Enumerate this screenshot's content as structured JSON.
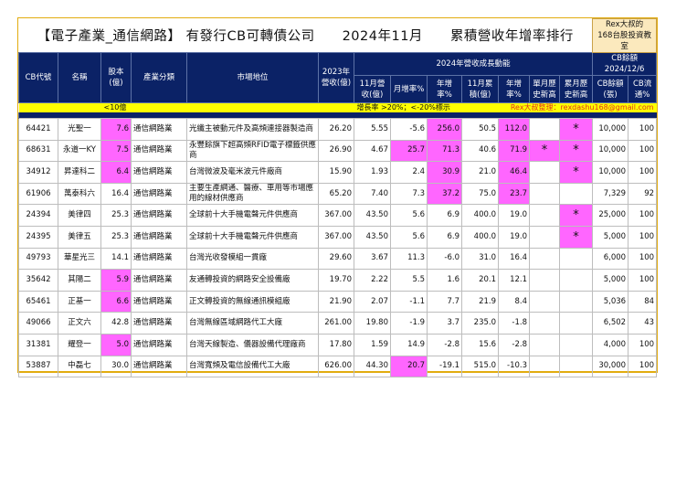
{
  "title": {
    "main": "【電子產業_通信網路】 有發行CB可轉債公司　　2024年11月　　累積營收年增率排行",
    "rex_line1": "Rex大叔的",
    "rex_line2": "168台股投資教室"
  },
  "header": {
    "cb_code": "CB代號",
    "name": "名稱",
    "capital": "股本(億)",
    "industry": "產業分類",
    "market": "市場地位",
    "rev2023": "2023年營收(億)",
    "group_growth": "2024年營收成長動能",
    "group_cb": "CB餘額 2024/12/6",
    "nov_rev": "11月營收(億)",
    "mom": "月增率%",
    "yoy": "年增率%",
    "nov_cum": "11月累積(億)",
    "cum_yoy": "年增率%",
    "month_high": "單月歷史新高",
    "cum_high": "累月歷史新高",
    "cb_balance": "CB餘額(張)",
    "cb_float": "CB流通%"
  },
  "notes": {
    "under10": "<10億",
    "growth_mark": "增長率 >20%；<-20%標示",
    "credit": "Rex大叔整理：rexdashu168@gmail.com"
  },
  "colors": {
    "navy": "#0b2266",
    "highlight": "#ff66ff",
    "yellow": "#ffff00",
    "border": "#e2ac10"
  },
  "rows": [
    {
      "cells": [
        "64421",
        "光聖一",
        "7.6",
        "通信網路業",
        "光纖主被動元件及高頻連接器製造商",
        "26.20",
        "5.55",
        "-5.6",
        "256.0",
        "50.5",
        "112.0",
        "",
        "*",
        "10,000",
        "100"
      ],
      "hl": [
        2,
        8,
        10,
        12
      ]
    },
    {
      "cells": [
        "68631",
        "永道一KY",
        "7.5",
        "通信網路業",
        "永豐餘旗下超高頻RFID電子標籤供應商",
        "26.90",
        "4.67",
        "25.7",
        "71.3",
        "40.6",
        "71.9",
        "*",
        "*",
        "10,000",
        "100"
      ],
      "hl": [
        2,
        7,
        8,
        10,
        11,
        12
      ]
    },
    {
      "cells": [
        "34912",
        "昇達科二",
        "6.4",
        "通信網路業",
        "台灣微波及毫米波元件廠商",
        "15.90",
        "1.93",
        "2.4",
        "30.9",
        "21.0",
        "46.4",
        "",
        "*",
        "10,000",
        "100"
      ],
      "hl": [
        2,
        8,
        10,
        12
      ]
    },
    {
      "cells": [
        "61906",
        "萬泰科六",
        "16.4",
        "通信網路業",
        "主要生產網通、醫療、車用等市場應用的線材供應商",
        "65.20",
        "7.40",
        "7.3",
        "37.2",
        "75.0",
        "23.7",
        "",
        "",
        "7,329",
        "92"
      ],
      "hl": [
        8,
        10
      ]
    },
    {
      "cells": [
        "24394",
        "美律四",
        "25.3",
        "通信網路業",
        "全球前十大手機電聲元件供應商",
        "367.00",
        "43.50",
        "5.6",
        "6.9",
        "400.0",
        "19.0",
        "",
        "*",
        "25,000",
        "100"
      ],
      "hl": [
        12
      ]
    },
    {
      "cells": [
        "24395",
        "美律五",
        "25.3",
        "通信網路業",
        "全球前十大手機電聲元件供應商",
        "367.00",
        "43.50",
        "5.6",
        "6.9",
        "400.0",
        "19.0",
        "",
        "*",
        "5,000",
        "100"
      ],
      "hl": [
        12
      ]
    },
    {
      "cells": [
        "49793",
        "華星光三",
        "14.1",
        "通信網路業",
        "台灣光收發模組一貫廠",
        "29.60",
        "3.67",
        "11.3",
        "-6.0",
        "31.0",
        "16.4",
        "",
        "",
        "6,000",
        "100"
      ],
      "hl": []
    },
    {
      "cells": [
        "35642",
        "其陽二",
        "5.9",
        "通信網路業",
        "友通轉投資的網路安全設備廠",
        "19.70",
        "2.22",
        "5.5",
        "1.6",
        "20.1",
        "12.1",
        "",
        "",
        "5,000",
        "100"
      ],
      "hl": [
        2
      ]
    },
    {
      "cells": [
        "65461",
        "正基一",
        "6.6",
        "通信網路業",
        "正文轉投資的無線通訊模組廠",
        "21.90",
        "2.07",
        "-1.1",
        "7.7",
        "21.9",
        "8.4",
        "",
        "",
        "5,036",
        "84"
      ],
      "hl": [
        2
      ]
    },
    {
      "cells": [
        "49066",
        "正文六",
        "42.8",
        "通信網路業",
        "台灣無線區域網路代工大廠",
        "261.00",
        "19.80",
        "-1.9",
        "3.7",
        "235.0",
        "-1.8",
        "",
        "",
        "6,502",
        "43"
      ],
      "hl": []
    },
    {
      "cells": [
        "31381",
        "耀登一",
        "5.0",
        "通信網路業",
        "台灣天線製造、儀器設備代理廠商",
        "17.80",
        "1.59",
        "14.9",
        "-2.8",
        "15.6",
        "-2.8",
        "",
        "",
        "4,000",
        "100"
      ],
      "hl": [
        2
      ]
    },
    {
      "cells": [
        "53887",
        "中磊七",
        "30.0",
        "通信網路業",
        "台灣寬頻及電信設備代工大廠",
        "626.00",
        "44.30",
        "20.7",
        "-19.1",
        "515.0",
        "-10.3",
        "",
        "",
        "30,000",
        "100"
      ],
      "hl": [
        7
      ]
    }
  ]
}
